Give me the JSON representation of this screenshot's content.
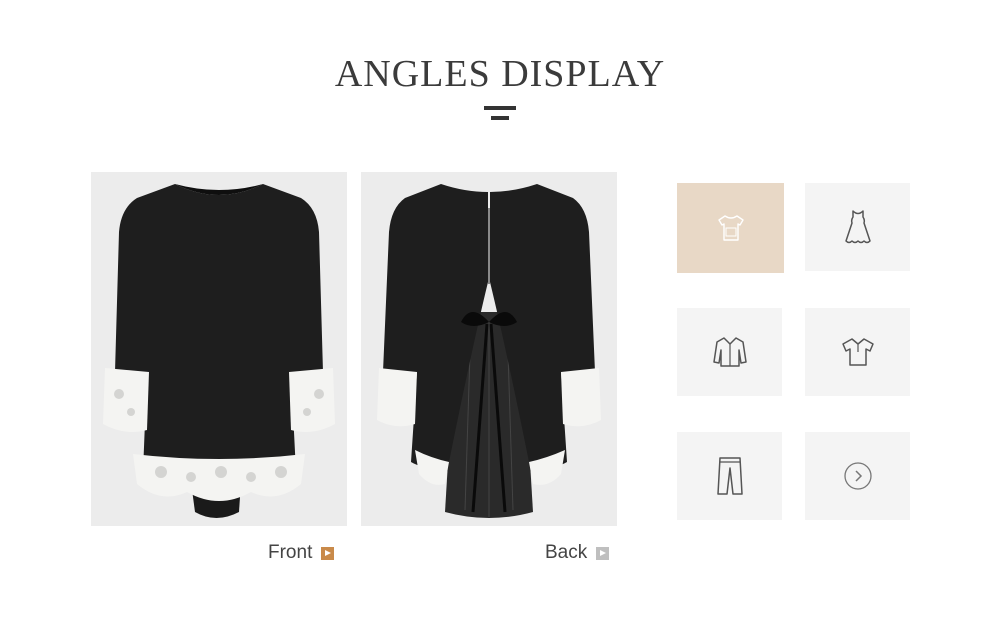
{
  "section_title": "ANGLES DISPLAY",
  "colors": {
    "accent": "#c98a4a",
    "tile_active": "#e8d8c6",
    "tile": "#f4f4f4",
    "title": "#3b3b3b"
  },
  "photos": [
    {
      "id": "front",
      "caption": "Front",
      "arrow_color": "#c98a4a"
    },
    {
      "id": "back",
      "caption": "Back",
      "arrow_color": "#bfbfbf"
    }
  ],
  "angle_tiles": [
    {
      "icon": "tshirt-icon",
      "active": true
    },
    {
      "icon": "dress-icon",
      "active": false
    },
    {
      "icon": "shirt-icon",
      "active": false
    },
    {
      "icon": "polo-icon",
      "active": false
    },
    {
      "icon": "pants-icon",
      "active": false
    },
    {
      "icon": "chevron-right-icon",
      "active": false
    }
  ]
}
